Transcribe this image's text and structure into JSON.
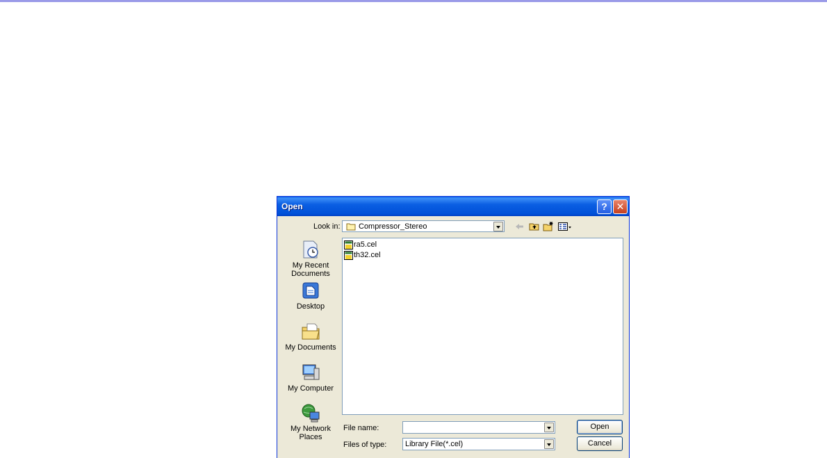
{
  "dialog": {
    "title": "Open",
    "help_glyph": "?",
    "close_glyph": "✕"
  },
  "look_in": {
    "label": "Look in:",
    "value": "Compressor_Stereo"
  },
  "toolbar": {
    "icons": [
      "back-icon",
      "up-folder-icon",
      "new-folder-icon",
      "view-menu-icon"
    ]
  },
  "places": [
    {
      "label": "My Recent Documents",
      "icon": "recent-documents-icon"
    },
    {
      "label": "Desktop",
      "icon": "desktop-icon"
    },
    {
      "label": "My Documents",
      "icon": "my-documents-icon"
    },
    {
      "label": "My Computer",
      "icon": "my-computer-icon"
    },
    {
      "label": "My Network Places",
      "icon": "network-places-icon"
    }
  ],
  "files": [
    {
      "name": "ra5.cel",
      "icon": "cel-file-icon"
    },
    {
      "name": "th32.cel",
      "icon": "cel-file-icon"
    }
  ],
  "file_name": {
    "label": "File name:",
    "value": ""
  },
  "file_type": {
    "label": "Files of type:",
    "value": "Library File(*.cel)"
  },
  "buttons": {
    "open": "Open",
    "cancel": "Cancel"
  },
  "colors": {
    "title_bar": "#0b5fe3",
    "dialog_bg": "#ece9d8",
    "close_button": "#c6401e",
    "top_strip": "#9a9ae8"
  }
}
